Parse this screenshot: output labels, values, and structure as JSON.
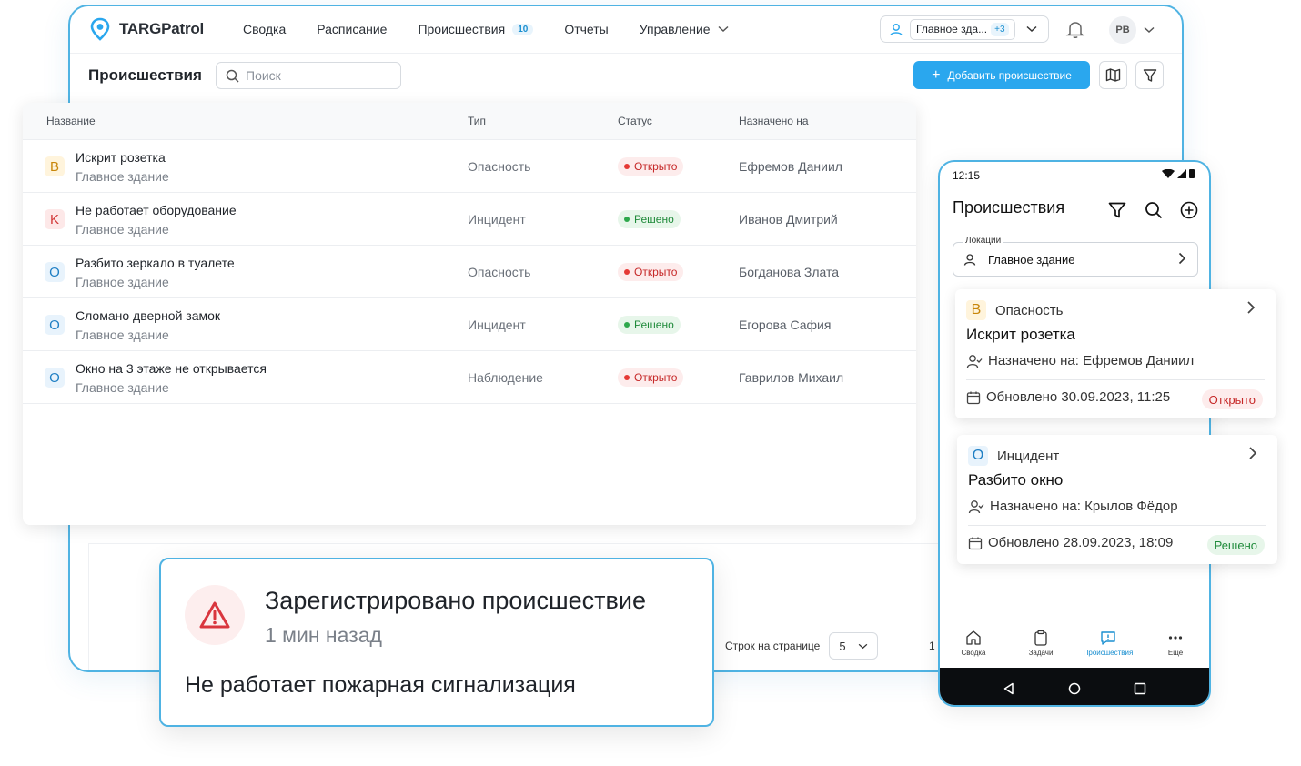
{
  "brand": {
    "name": "TARGPatrol",
    "accent": "#2aa7ee"
  },
  "nav": {
    "items": [
      {
        "label": "Сводка"
      },
      {
        "label": "Расписание"
      },
      {
        "label": "Происшествия",
        "badge": "10"
      },
      {
        "label": "Отчеты"
      },
      {
        "label": "Управление"
      }
    ]
  },
  "location_chip": {
    "label": "Главное зда...",
    "more": "+3"
  },
  "user": {
    "initials": "PB"
  },
  "page": {
    "title": "Происшествия",
    "search_placeholder": "Поиск",
    "add_button": "Добавить происшествие"
  },
  "table": {
    "columns": [
      "Название",
      "Тип",
      "Статус",
      "Назначено на"
    ],
    "rows": [
      {
        "sev": "B",
        "title": "Искрит розетка",
        "location": "Главное здание",
        "type": "Опасность",
        "status": "Открыто",
        "status_kind": "open",
        "assignee": "Ефремов Даниил"
      },
      {
        "sev": "K",
        "title": "Не работает оборудование",
        "location": "Главное здание",
        "type": "Инцидент",
        "status": "Решено",
        "status_kind": "done",
        "assignee": "Иванов Дмитрий"
      },
      {
        "sev": "O",
        "title": "Разбито зеркало в туалете",
        "location": "Главное здание",
        "type": "Опасность",
        "status": "Открыто",
        "status_kind": "open",
        "assignee": "Богданова Злата"
      },
      {
        "sev": "O",
        "title": "Сломано дверной замок",
        "location": "Главное здание",
        "type": "Инцидент",
        "status": "Решено",
        "status_kind": "done",
        "assignee": "Егорова Сафия"
      },
      {
        "sev": "O",
        "title": "Окно на 3 этаже не открывается",
        "location": "Главное здание",
        "type": "Наблюдение",
        "status": "Открыто",
        "status_kind": "open",
        "assignee": "Гаврилов Михаил"
      }
    ]
  },
  "pagination": {
    "rows_label": "Строк на странице",
    "rows_value": "5",
    "range": "1 -"
  },
  "notification": {
    "title": "Зарегистрировано происшествие",
    "time": "1 мин назад",
    "body": "Не работает пожарная сигнализация"
  },
  "phone": {
    "time": "12:15",
    "title": "Происшествия",
    "location_label": "Локации",
    "location_value": "Главное здание",
    "cards": [
      {
        "sev": "B",
        "type": "Опасность",
        "title": "Искрит розетка",
        "assigned": "Назначено на: Ефремов Даниил",
        "updated": "Обновлено 30.09.2023, 11:25",
        "status": "Открыто",
        "status_kind": "open"
      },
      {
        "sev": "O",
        "type": "Инцидент",
        "title": "Разбито окно",
        "assigned": "Назначено на: Крылов Фёдор",
        "updated": "Обновлено 28.09.2023, 18:09",
        "status": "Решено",
        "status_kind": "done"
      }
    ],
    "bottom_nav": [
      {
        "label": "Сводка",
        "icon": "home-icon"
      },
      {
        "label": "Задачи",
        "icon": "clipboard-icon"
      },
      {
        "label": "Происшествия",
        "icon": "alert-message-icon",
        "active": true
      },
      {
        "label": "Еще",
        "icon": "more-icon"
      }
    ]
  }
}
